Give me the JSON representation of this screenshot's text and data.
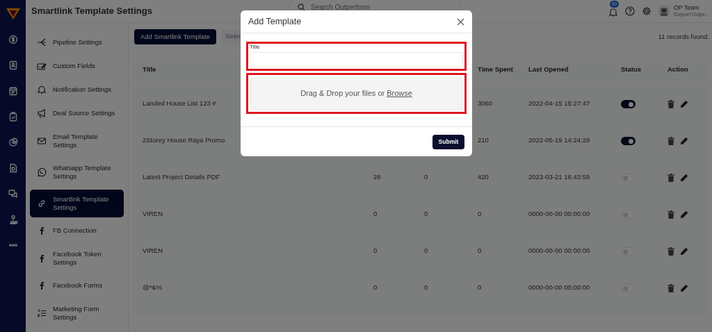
{
  "header": {
    "title": "Smartlink Template Settings",
    "search_placeholder": "Search Outperform",
    "notification_count": "50",
    "user_name": "OP Team",
    "user_role": "Support Outpe..."
  },
  "rail": [
    {
      "kind": "dollar"
    },
    {
      "kind": "contact"
    },
    {
      "kind": "calendar"
    },
    {
      "kind": "clipboard"
    },
    {
      "kind": "pie"
    },
    {
      "kind": "document"
    },
    {
      "kind": "chat"
    },
    {
      "kind": "people"
    },
    {
      "kind": "more"
    }
  ],
  "settings_menu": [
    {
      "kind": "pipeline",
      "label": "Pipeline Settings",
      "selected": false
    },
    {
      "kind": "fields",
      "label": "Custom Fields",
      "selected": false
    },
    {
      "kind": "bell",
      "label": "Notification Settings",
      "selected": false
    },
    {
      "kind": "megaphone",
      "label": "Deal Source Settings",
      "selected": false
    },
    {
      "kind": "mail",
      "label": "Email Template Settings",
      "selected": false
    },
    {
      "kind": "whatsapp",
      "label": "Whatsapp Template Settings",
      "selected": false
    },
    {
      "kind": "link",
      "label": "Smartlink Template Settings",
      "selected": true
    },
    {
      "kind": "facebook",
      "label": "FB Connection",
      "selected": false
    },
    {
      "kind": "facebook",
      "label": "Facebook Token Settings",
      "selected": false
    },
    {
      "kind": "facebook",
      "label": "Facebook Forms",
      "selected": false
    },
    {
      "kind": "list",
      "label": "Marketing Form Settings",
      "selected": false
    }
  ],
  "toolbar": {
    "add_button": "Add Smartlink Template",
    "search_placeholder": "Searc",
    "records": "11 records found."
  },
  "table": {
    "columns": {
      "title": "Title",
      "time_spent": "Time Spent",
      "last_opened": "Last Opened",
      "status": "Status",
      "action": "Action"
    },
    "rows": [
      {
        "title": "Landed House List 123 #",
        "time_spent": "3060",
        "last_opened": "2022-04-15 15:27:47",
        "on": true
      },
      {
        "title": "2Storey House Raya Promo",
        "time_spent": "210",
        "last_opened": "2022-05-19 14:24:28",
        "on": true
      },
      {
        "title": "Latest Project Details PDF",
        "column_2": "28",
        "column_3": "0",
        "time_spent": "420",
        "last_opened": "2023-03-21 16:43:59",
        "on": false
      },
      {
        "title": "VIREN",
        "column_2": "0",
        "column_3": "0",
        "time_spent": "0",
        "last_opened": "0000-00-00 00:00:00",
        "on": false
      },
      {
        "title": "VIREN",
        "column_2": "0",
        "column_3": "0",
        "time_spent": "0",
        "last_opened": "0000-00-00 00:00:00",
        "on": false
      },
      {
        "title": "@*&%",
        "column_2": "0",
        "column_3": "0",
        "time_spent": "0",
        "last_opened": "0000-00-00 00:00:00",
        "on": false
      }
    ]
  },
  "modal": {
    "title": "Add Template",
    "title_field": {
      "label": "Title",
      "highlighted": true
    },
    "dropzone": {
      "text": "Drag & Drop your files or",
      "link": "Browse",
      "highlighted": true
    },
    "submit": "Submit"
  }
}
